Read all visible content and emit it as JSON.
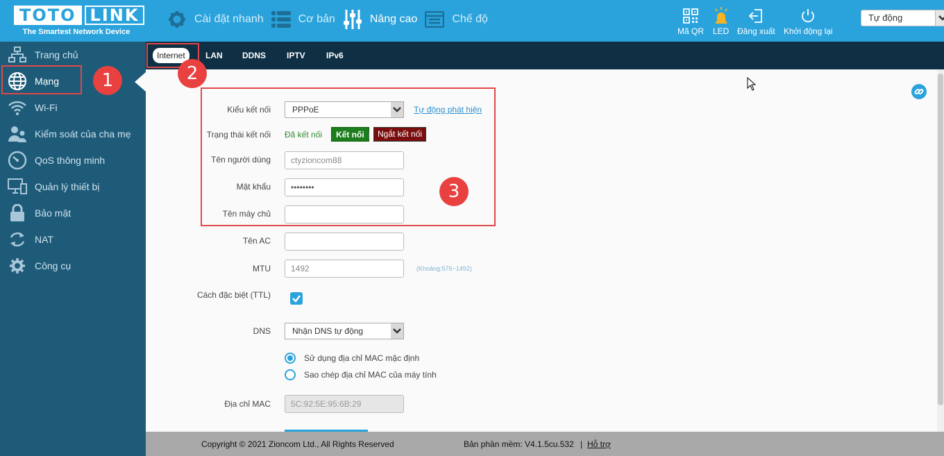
{
  "brand": {
    "logo_left": "TOTO",
    "logo_right": "LINK",
    "tagline": "The Smartest Network Device"
  },
  "topnav": [
    {
      "label": "Cài đặt nhanh",
      "icon": "gear-icon"
    },
    {
      "label": "Cơ bản",
      "icon": "list-icon"
    },
    {
      "label": "Nâng cao",
      "icon": "sliders-icon"
    },
    {
      "label": "Chế độ",
      "icon": "mode-icon"
    }
  ],
  "tools": [
    {
      "label": "Mã QR",
      "icon": "qr-code-icon"
    },
    {
      "label": "LED",
      "icon": "led-icon"
    },
    {
      "label": "Đăng xuất",
      "icon": "logout-icon"
    },
    {
      "label": "Khởi động lại",
      "icon": "power-icon"
    }
  ],
  "language": "Tự động",
  "sidebar": [
    {
      "label": "Trang chủ",
      "icon": "network-home-icon"
    },
    {
      "label": "Mạng",
      "icon": "globe-icon"
    },
    {
      "label": "Wi-Fi",
      "icon": "wifi-icon"
    },
    {
      "label": "Kiểm soát của cha mẹ",
      "icon": "parental-control-icon"
    },
    {
      "label": "QoS thông minh",
      "icon": "speedometer-icon"
    },
    {
      "label": "Quản lý thiết bị",
      "icon": "devices-icon"
    },
    {
      "label": "Bảo mật",
      "icon": "lock-icon"
    },
    {
      "label": "NAT",
      "icon": "refresh-icon"
    },
    {
      "label": "Công cụ",
      "icon": "gear-icon"
    }
  ],
  "subtabs": [
    "Internet",
    "LAN",
    "DDNS",
    "IPTV",
    "IPv6"
  ],
  "form": {
    "connection_type_label": "Kiểu kết nối",
    "connection_type_value": "PPPoE",
    "auto_detect": "Tự động phát hiện",
    "status_label": "Trạng thái kết nối",
    "status_value": "Đã kết nối",
    "connect_button": "Kết nối",
    "separator": "|",
    "disconnect_button": "Ngắt kết nối",
    "username_label": "Tên người dùng",
    "username_value": "ctyzioncom88",
    "password_label": "Mật khẩu",
    "password_value": "••••••••",
    "server_label": "Tên máy chủ",
    "server_value": "",
    "ac_label": "Tên AC",
    "ac_value": "",
    "mtu_label": "MTU",
    "mtu_value": "1492",
    "mtu_hint": "(Khoảng:576~1492)",
    "ttl_label": "Cách đặc biệt (TTL)",
    "ttl_checked": true,
    "dns_label": "DNS",
    "dns_value": "Nhận DNS tự động",
    "mac_option_default": "Sử dụng địa chỉ MAC mặc định",
    "mac_option_clone": "Sao chép địa chỉ MAC của máy tính",
    "mac_label": "Địa chỉ MAC",
    "mac_value": "5C:92:5E:95:6B:29"
  },
  "annotations": {
    "badge_1": "1",
    "badge_2": "2",
    "badge_3": "3"
  },
  "footer": {
    "copyright": "Copyright © 2021 Zioncom Ltd., All Rights Reserved",
    "firmware": "Bản phần mềm: V4.1.5cu.532",
    "separator": "|",
    "help": "Hỗ trợ"
  },
  "colors": {
    "header": "#2aa3dc",
    "sidebar": "#1e5b79",
    "subnav": "#0e2f44",
    "annotation": "#e8413f",
    "connected_text": "#2e8b2e"
  }
}
